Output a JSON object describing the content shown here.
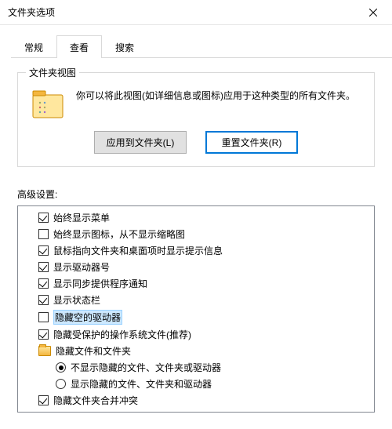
{
  "window": {
    "title": "文件夹选项"
  },
  "tabs": {
    "general": "常规",
    "view": "查看",
    "search": "搜索",
    "active": "view"
  },
  "groupbox": {
    "label": "文件夹视图",
    "desc": "你可以将此视图(如详细信息或图标)应用于这种类型的所有文件夹。",
    "apply_btn": "应用到文件夹(L)",
    "reset_btn": "重置文件夹(R)"
  },
  "advanced": {
    "label": "高级设置:",
    "items": [
      {
        "type": "checkbox",
        "checked": true,
        "label": "始终显示菜单",
        "level": 1
      },
      {
        "type": "checkbox",
        "checked": false,
        "label": "始终显示图标，从不显示缩略图",
        "level": 1
      },
      {
        "type": "checkbox",
        "checked": true,
        "label": "鼠标指向文件夹和桌面项时显示提示信息",
        "level": 1
      },
      {
        "type": "checkbox",
        "checked": true,
        "label": "显示驱动器号",
        "level": 1
      },
      {
        "type": "checkbox",
        "checked": true,
        "label": "显示同步提供程序通知",
        "level": 1
      },
      {
        "type": "checkbox",
        "checked": true,
        "label": "显示状态栏",
        "level": 1
      },
      {
        "type": "checkbox",
        "checked": false,
        "label": "隐藏空的驱动器",
        "level": 1,
        "selected": true
      },
      {
        "type": "checkbox",
        "checked": true,
        "label": "隐藏受保护的操作系统文件(推荐)",
        "level": 1
      },
      {
        "type": "folder",
        "label": "隐藏文件和文件夹",
        "level": 1
      },
      {
        "type": "radio",
        "checked": true,
        "label": "不显示隐藏的文件、文件夹或驱动器",
        "level": 2
      },
      {
        "type": "radio",
        "checked": false,
        "label": "显示隐藏的文件、文件夹和驱动器",
        "level": 2
      },
      {
        "type": "checkbox",
        "checked": true,
        "label": "隐藏文件夹合并冲突",
        "level": 1
      }
    ]
  }
}
